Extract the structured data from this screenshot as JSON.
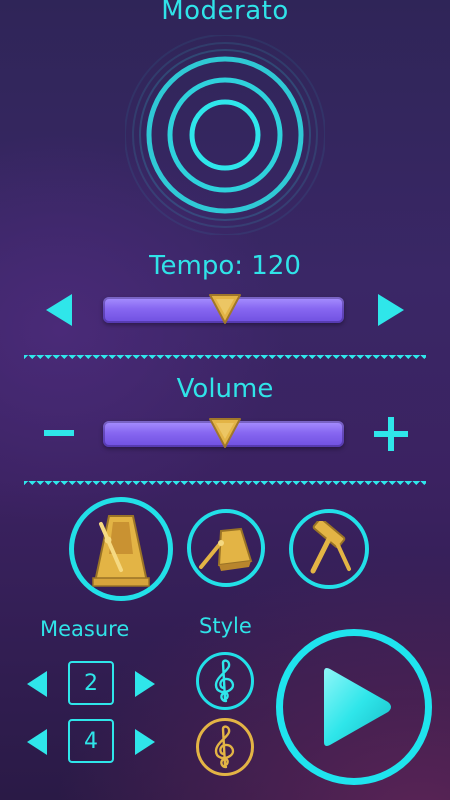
{
  "header": {
    "tempo_name": "Moderato"
  },
  "tempo": {
    "label": "Tempo:",
    "value": "120",
    "slider_level": 0.48
  },
  "volume": {
    "label": "Volume",
    "minus": "−",
    "plus": "+",
    "slider_level": 0.48
  },
  "sounds": [
    {
      "name": "metronome",
      "icon": "metronome-icon",
      "selected": true
    },
    {
      "name": "cowbell",
      "icon": "cowbell-icon",
      "selected": false
    },
    {
      "name": "woodblock",
      "icon": "woodblock-icon",
      "selected": false
    }
  ],
  "measure": {
    "label": "Measure",
    "top_value": "2",
    "bottom_value": "4"
  },
  "style": {
    "label": "Style",
    "options": [
      "treble-clef-cyan",
      "treble-clef-gold"
    ]
  },
  "colors": {
    "accent": "#2fe6ea",
    "gold": "#e6b84d",
    "slider": "#8767f1"
  }
}
